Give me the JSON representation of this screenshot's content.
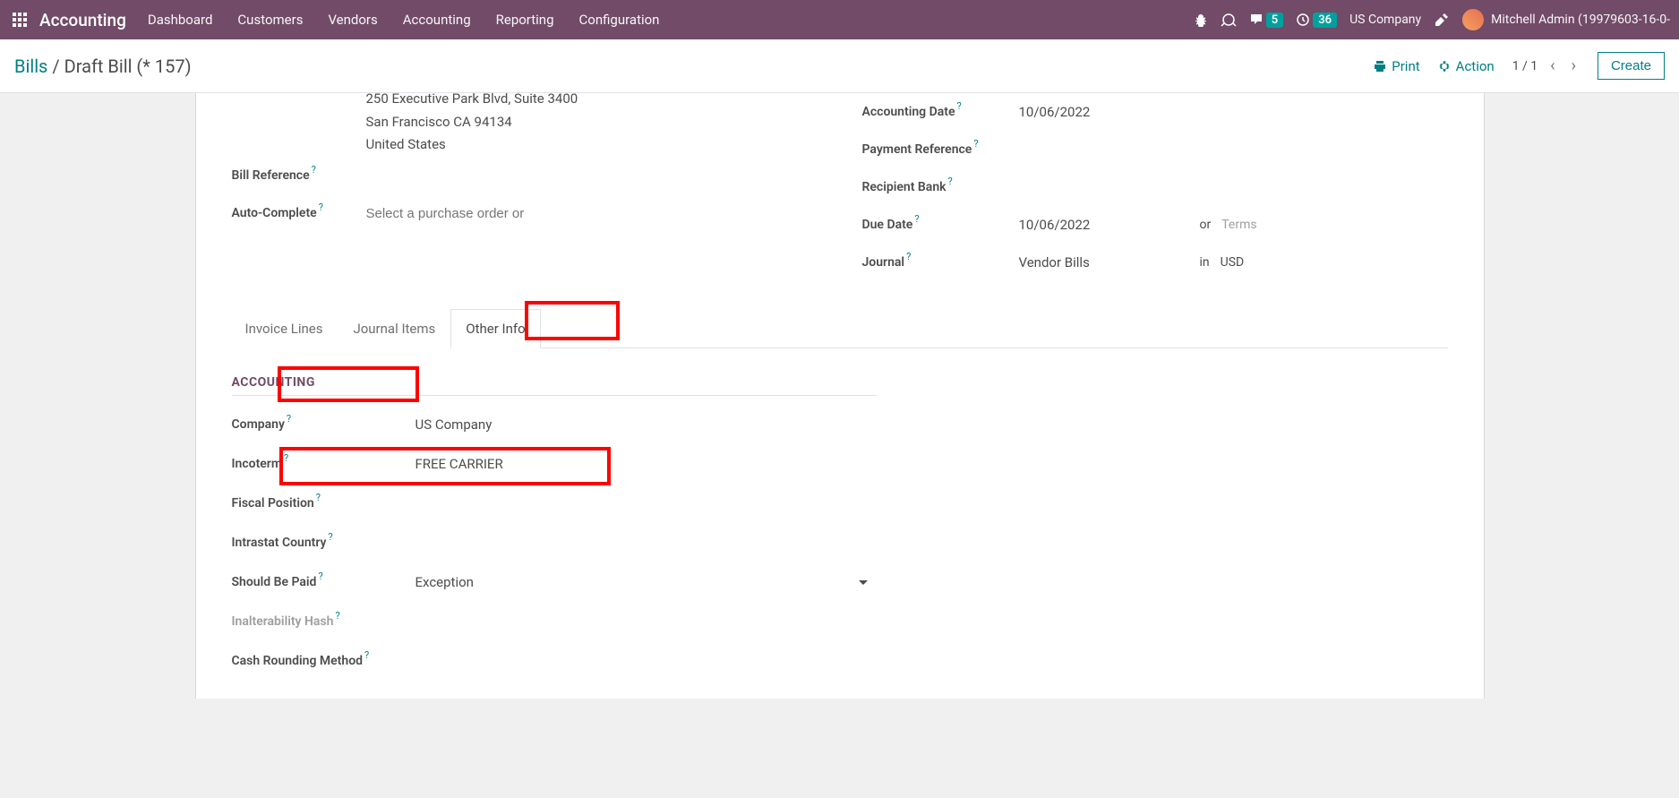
{
  "nav": {
    "brand": "Accounting",
    "items": [
      "Dashboard",
      "Customers",
      "Vendors",
      "Accounting",
      "Reporting",
      "Configuration"
    ],
    "msg_count": "5",
    "clock_count": "36",
    "company": "US Company",
    "user": "Mitchell Admin (19979603-16-0-"
  },
  "breadcrumb": {
    "root": "Bills",
    "current": "Draft Bill (* 157)"
  },
  "cp": {
    "print": "Print",
    "action": "Action",
    "pager": "1 / 1",
    "create": "Create"
  },
  "left": {
    "addr1": "250 Executive Park Blvd, Suite 3400",
    "addr2": "San Francisco CA 94134",
    "addr3": "United States",
    "bill_ref": "Bill Reference",
    "auto_complete": "Auto-Complete",
    "auto_complete_ph": "Select a purchase order or"
  },
  "right": {
    "accounting_date": "Accounting Date",
    "accounting_date_val": "10/06/2022",
    "payment_ref": "Payment Reference",
    "recipient_bank": "Recipient Bank",
    "due_date": "Due Date",
    "due_date_val": "10/06/2022",
    "or": "or",
    "terms_ph": "Terms",
    "journal": "Journal",
    "journal_val": "Vendor Bills",
    "in": "in",
    "currency": "USD"
  },
  "tabs": {
    "t1": "Invoice Lines",
    "t2": "Journal Items",
    "t3": "Other Info"
  },
  "section": {
    "title": "ACCOUNTING",
    "company": "Company",
    "company_val": "US Company",
    "incoterm": "Incoterm",
    "incoterm_val": "FREE CARRIER",
    "fiscal": "Fiscal Position",
    "intrastat": "Intrastat Country",
    "should_be_paid": "Should Be Paid",
    "should_be_paid_val": "Exception",
    "hash": "Inalterability Hash",
    "rounding": "Cash Rounding Method"
  }
}
